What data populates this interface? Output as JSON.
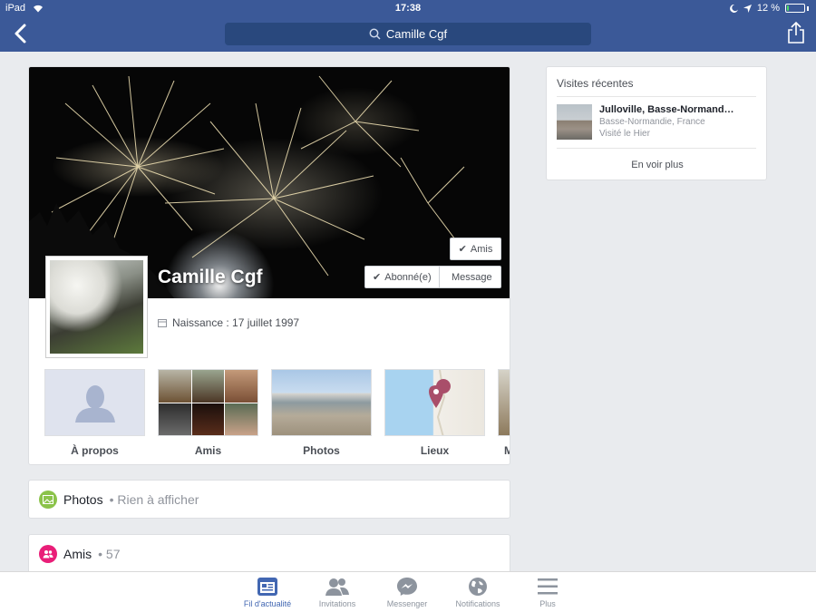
{
  "status_bar": {
    "device": "iPad",
    "time": "17:38",
    "battery_percent": "12 %",
    "battery_level": 0.12
  },
  "header": {
    "search_text": "Camille Cgf"
  },
  "profile": {
    "name": "Camille Cgf",
    "friends_button": "Amis",
    "follow_button": "Abonné(e)",
    "message_button": "Message",
    "birthday": "Naissance : 17 juillet 1997",
    "tiles": [
      {
        "label": "À propos"
      },
      {
        "label": "Amis"
      },
      {
        "label": "Photos"
      },
      {
        "label": "Lieux"
      },
      {
        "label": "M"
      }
    ]
  },
  "sections": {
    "photos": {
      "title": "Photos",
      "subtitle": "• Rien à afficher",
      "icon_color": "#8bc34a"
    },
    "friends": {
      "title": "Amis",
      "subtitle": "• 57",
      "icon_color": "#e91e78"
    }
  },
  "recent_visits": {
    "title": "Visites récentes",
    "item": {
      "name": "Julloville, Basse-Normand…",
      "region": "Basse-Normandie, France",
      "visited": "Visité le Hier"
    },
    "more": "En voir plus"
  },
  "tabbar": {
    "tabs": [
      {
        "label": "Fil d'actualité",
        "icon": "news-feed-icon",
        "active": true
      },
      {
        "label": "Invitations",
        "icon": "friend-requests-icon"
      },
      {
        "label": "Messenger",
        "icon": "messenger-icon"
      },
      {
        "label": "Notifications",
        "icon": "globe-icon"
      },
      {
        "label": "Plus",
        "icon": "menu-icon"
      }
    ]
  },
  "colors": {
    "header": "#3b5998",
    "active_tab": "#4267b2"
  }
}
